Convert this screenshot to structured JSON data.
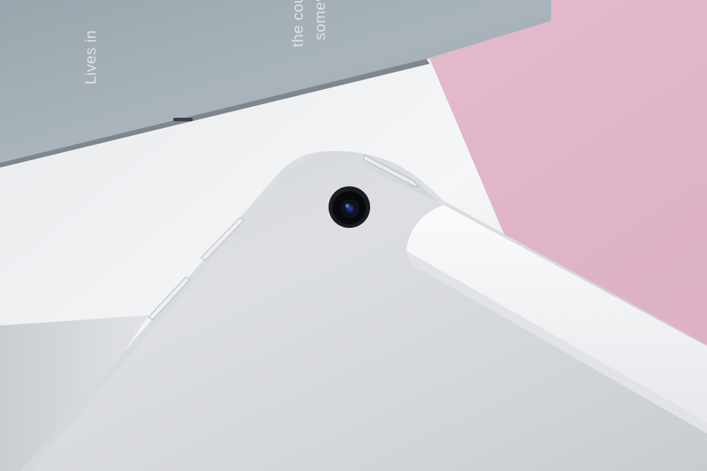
{
  "photo": {
    "book_cover_text": [
      "Lives in",
      "the cou",
      "somev"
    ]
  },
  "colors": {
    "background_pink": "#e2b5c9",
    "book_grey": "#a4aeb5",
    "white_box": "#f1f2f4",
    "tablet_silver": "#d8dadc",
    "antenna_strip": "#f4f5f6",
    "camera_lens": "#0c0d12"
  }
}
